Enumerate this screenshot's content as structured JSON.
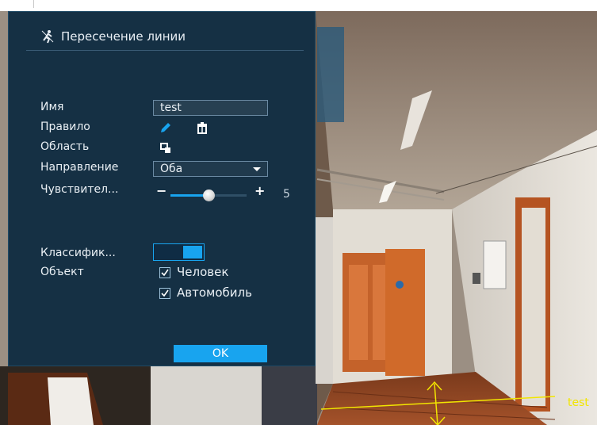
{
  "colors": {
    "accent": "#18a4ef",
    "panel_bg": "#102c42",
    "line_overlay": "#f2e600"
  },
  "header": {
    "title": "Пересечение линии",
    "icon": "running-man-line-icon"
  },
  "form": {
    "name_label": "Имя",
    "name_value": "test",
    "rule_label": "Правило",
    "rule_icons": [
      "pencil-icon",
      "trash-icon"
    ],
    "area_label": "Область",
    "area_icon": "area-draw-icon",
    "direction_label": "Направление",
    "direction_value": "Оба",
    "sensitivity_label": "Чувствител...",
    "sensitivity_value": "5",
    "sensitivity_level_fraction": 0.5,
    "classification_label": "Классифик...",
    "classification_on": true,
    "object_label": "Объект",
    "objects": [
      {
        "label": "Человек",
        "checked": true
      },
      {
        "label": "Автомобиль",
        "checked": true
      }
    ],
    "ok_label": "OK"
  },
  "video_overlay": {
    "line_label": "test"
  }
}
